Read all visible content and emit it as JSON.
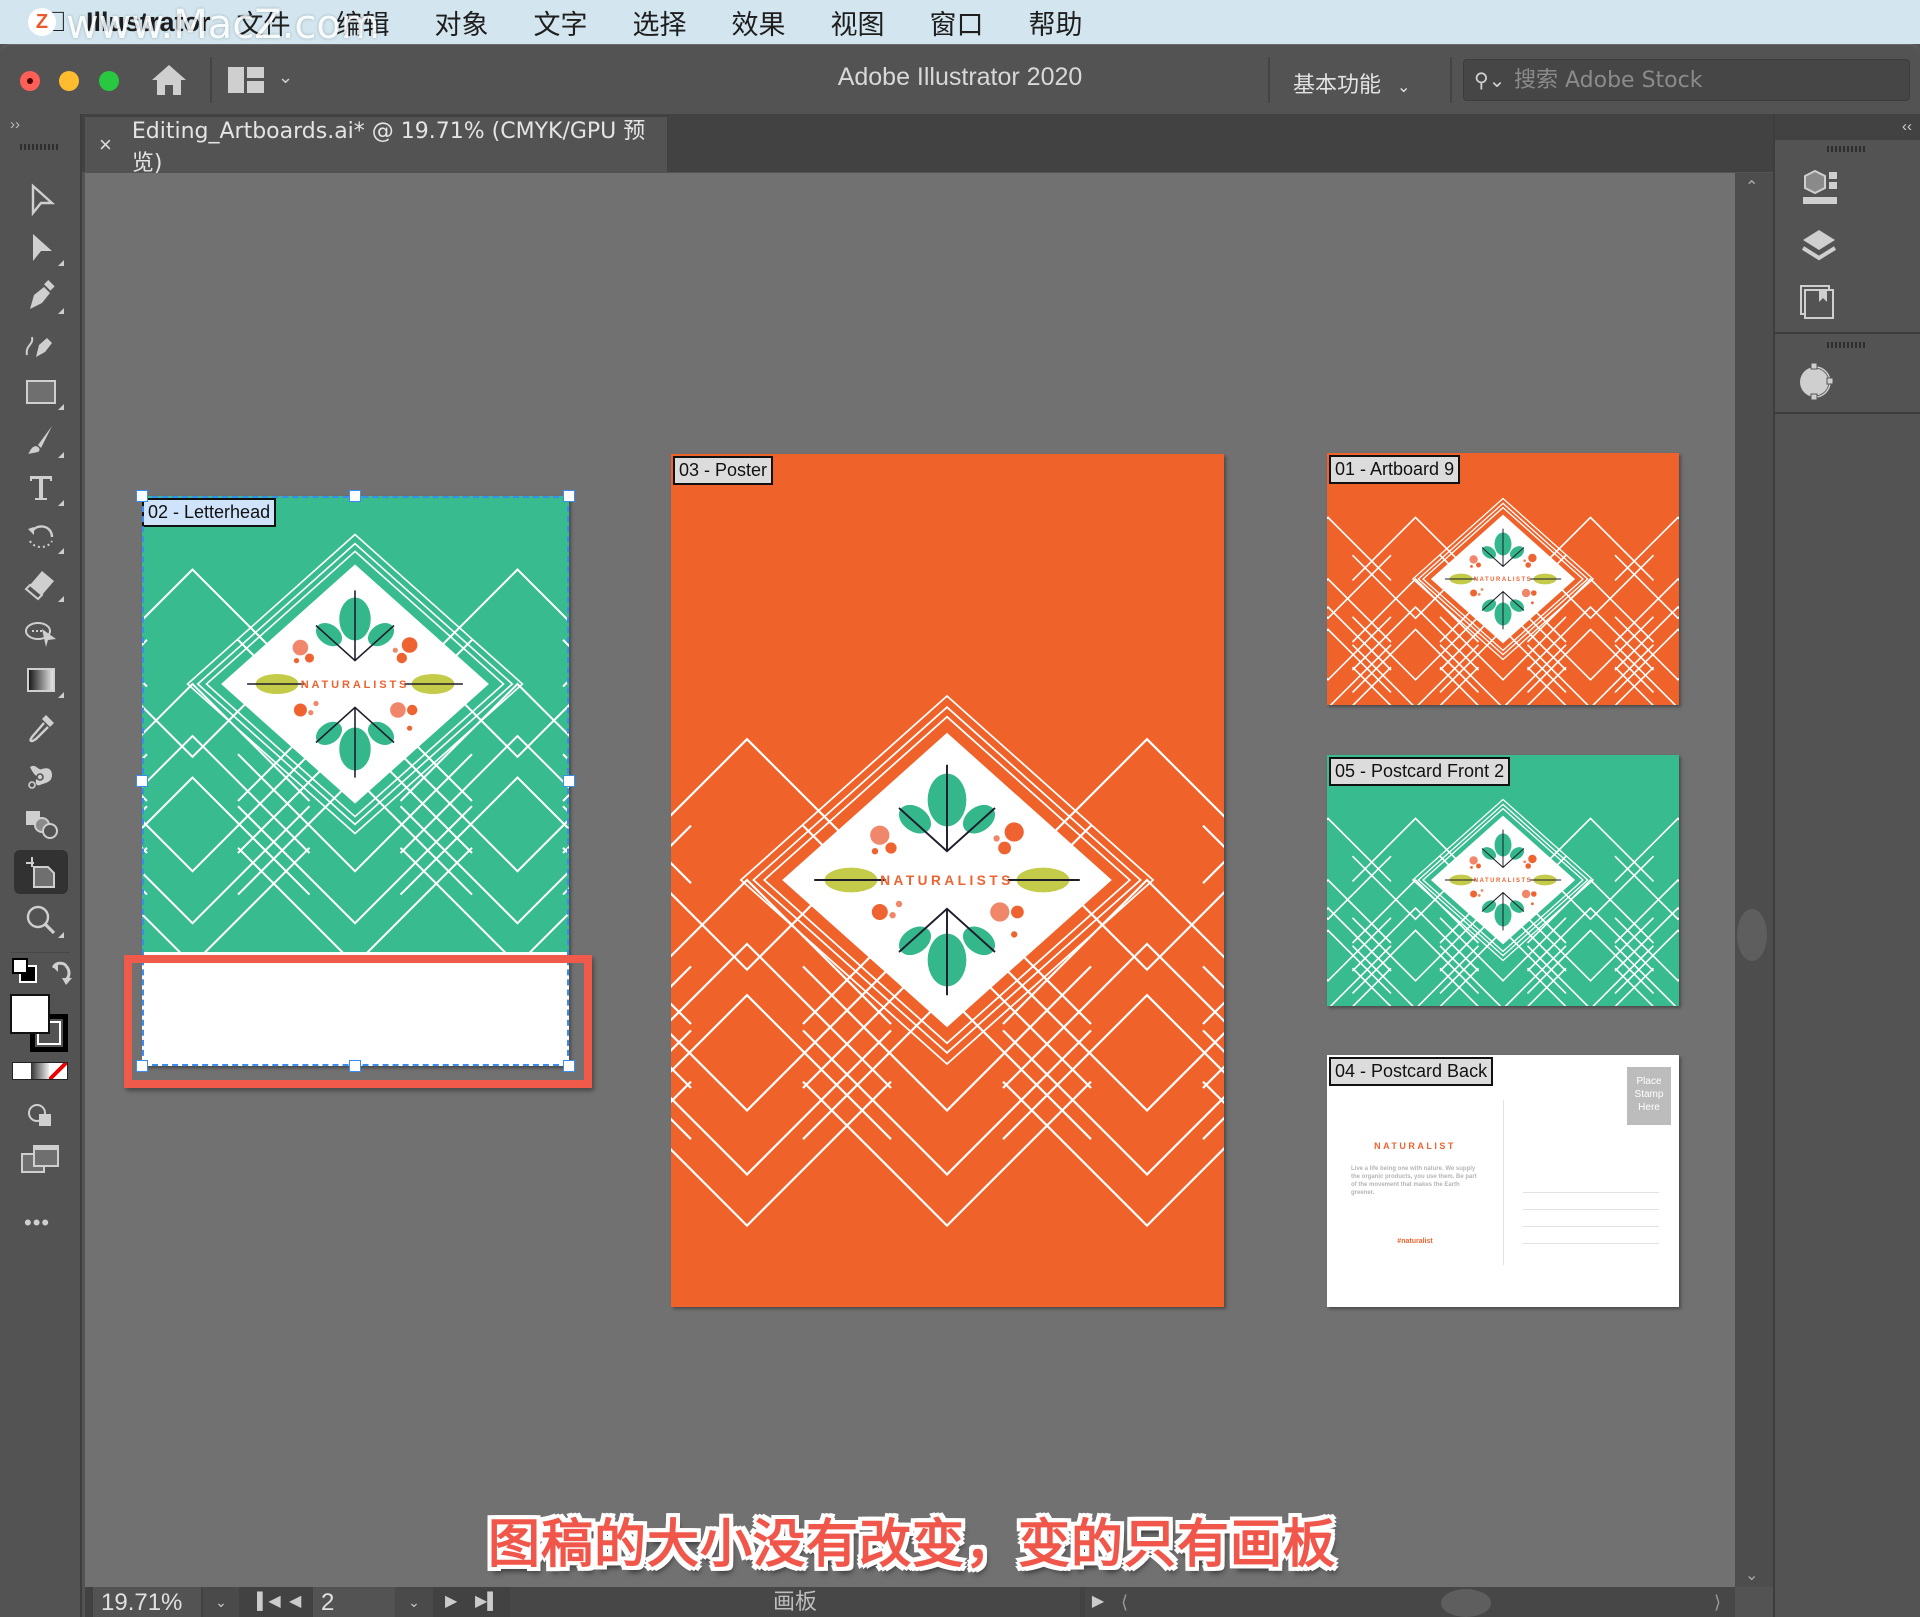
{
  "menubar": {
    "app_name": "Illustrator",
    "items": [
      "文件",
      "编辑",
      "对象",
      "文字",
      "选择",
      "效果",
      "视图",
      "窗口",
      "帮助"
    ],
    "watermark": "www.MacZ.com",
    "watermark_badge": "Z"
  },
  "titlebar": {
    "title": "Adobe Illustrator 2020",
    "workspace": "基本功能",
    "stock_search_placeholder": "搜索 Adobe Stock"
  },
  "document_tab": {
    "close": "×",
    "name": "Editing_Artboards.ai* @ 19.71% (CMYK/GPU 预览)"
  },
  "collapse_left": "››",
  "collapse_right": "‹‹",
  "toolbar": {
    "tools": [
      {
        "name": "selection-tool",
        "icon": "selection-arrow-icon"
      },
      {
        "name": "direct-selection-tool",
        "icon": "direct-selection-icon"
      },
      {
        "name": "pen-tool",
        "icon": "pen-icon"
      },
      {
        "name": "curvature-tool",
        "icon": "curvature-pen-icon"
      },
      {
        "name": "rectangle-tool",
        "icon": "rectangle-icon"
      },
      {
        "name": "paintbrush-tool",
        "icon": "paintbrush-icon"
      },
      {
        "name": "type-tool",
        "icon": "type-icon"
      },
      {
        "name": "rotate-tool",
        "icon": "rotate-icon"
      },
      {
        "name": "eraser-tool",
        "icon": "eraser-icon"
      },
      {
        "name": "free-transform-tool",
        "icon": "free-transform-icon"
      },
      {
        "name": "gradient-tool",
        "icon": "gradient-icon"
      },
      {
        "name": "eyedropper-tool",
        "icon": "eyedropper-icon"
      },
      {
        "name": "puppet-warp-tool",
        "icon": "puppet-warp-icon"
      },
      {
        "name": "shape-builder-tool",
        "icon": "shape-builder-icon"
      },
      {
        "name": "artboard-tool",
        "icon": "artboard-icon",
        "active": true
      },
      {
        "name": "zoom-tool",
        "icon": "zoom-icon"
      }
    ],
    "more": "•••"
  },
  "artboards": [
    {
      "id": "letterhead",
      "label": "02 - Letterhead",
      "theme": "green",
      "selected": true
    },
    {
      "id": "poster",
      "label": "03 - Poster",
      "theme": "orange"
    },
    {
      "id": "artboard9",
      "label": "01 - Artboard 9",
      "theme": "orange"
    },
    {
      "id": "postcard-front-2",
      "label": "05 - Postcard Front 2",
      "theme": "green"
    },
    {
      "id": "postcard-back",
      "label": "04 - Postcard Back",
      "theme": "white"
    }
  ],
  "logo_text": "NATURALISTS",
  "postcard_back": {
    "heading": "NATURALIST",
    "body": "Live a life being one with nature. We supply the organic products, you use them. Be part of the movement that makes the Earth greener.",
    "hashtag": "#naturalist",
    "stamp": [
      "Place",
      "Stamp",
      "Here"
    ]
  },
  "caption": "图稿的大小没有改变，变的只有画板",
  "statusbar": {
    "zoom": "19.71%",
    "artboard_number": "2",
    "label": "画板"
  },
  "colors": {
    "green": "#38bb8e",
    "orange": "#ef622a",
    "leaf_green": "#35b78c",
    "leaf_yellow": "#c4cb48",
    "dot_orange": "#ee6330",
    "dot_salmon": "#f0866a",
    "highlight": "#f05a4a",
    "selection": "#3a8df0"
  }
}
